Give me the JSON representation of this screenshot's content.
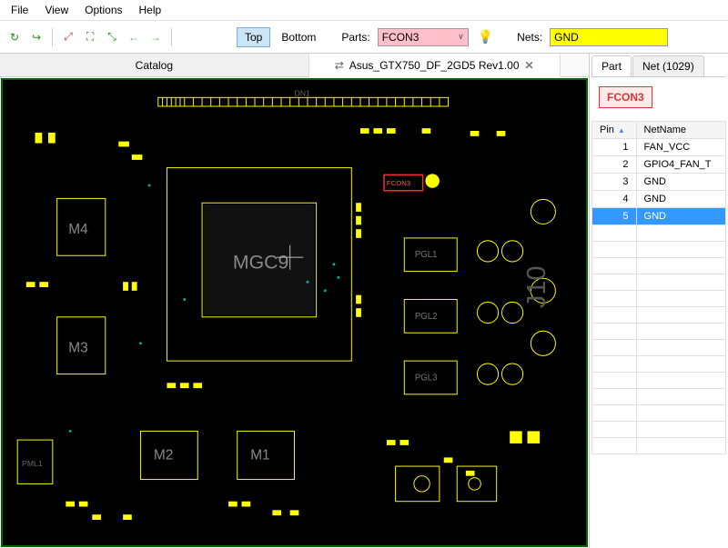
{
  "menu": {
    "items": [
      "File",
      "View",
      "Options",
      "Help"
    ]
  },
  "toolbar": {
    "layer_top": "Top",
    "layer_bottom": "Bottom",
    "parts_label": "Parts:",
    "parts_value": "FCON3",
    "nets_label": "Nets:",
    "nets_value": "GND"
  },
  "tabs": {
    "catalog": "Catalog",
    "board": "Asus_GTX750_DF_2GD5 Rev1.00"
  },
  "board": {
    "labels": {
      "mgc9": "MGC9",
      "m1": "M1",
      "m2": "M2",
      "m3": "M3",
      "m4": "M4",
      "pgl1": "PGL1",
      "pgl2": "PGL2",
      "pgl3": "PGL3",
      "pml1": "PML1",
      "j10": "J10",
      "dn1": "DN1",
      "fcon3": "FCON3"
    }
  },
  "sidebar": {
    "tab_part": "Part",
    "tab_net": "Net (1029)",
    "selected_part": "FCON3",
    "col_pin": "Pin",
    "col_net": "NetName",
    "rows": [
      {
        "pin": "1",
        "net": "FAN_VCC"
      },
      {
        "pin": "2",
        "net": "GPIO4_FAN_T"
      },
      {
        "pin": "3",
        "net": "GND"
      },
      {
        "pin": "4",
        "net": "GND"
      },
      {
        "pin": "5",
        "net": "GND"
      }
    ],
    "selected_row": 4
  }
}
